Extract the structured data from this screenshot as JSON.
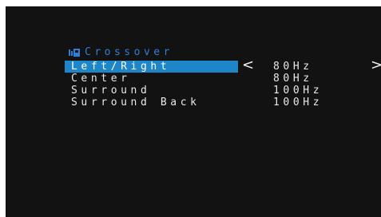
{
  "header": {
    "icon": "speaker-icon",
    "title": "Crossover"
  },
  "menu": {
    "items": [
      {
        "label": "Left/Right",
        "value": "80Hz",
        "selected": true
      },
      {
        "label": "Center",
        "value": "80Hz",
        "selected": false
      },
      {
        "label": "Surround",
        "value": "100Hz",
        "selected": false
      },
      {
        "label": "Surround Back",
        "value": "100Hz",
        "selected": false
      }
    ],
    "arrow_left": "<",
    "arrow_right": ">"
  },
  "colors": {
    "background": "#121212",
    "highlight": "#1e86c8",
    "header": "#2f7fd6",
    "text": "#e8e8e8"
  }
}
